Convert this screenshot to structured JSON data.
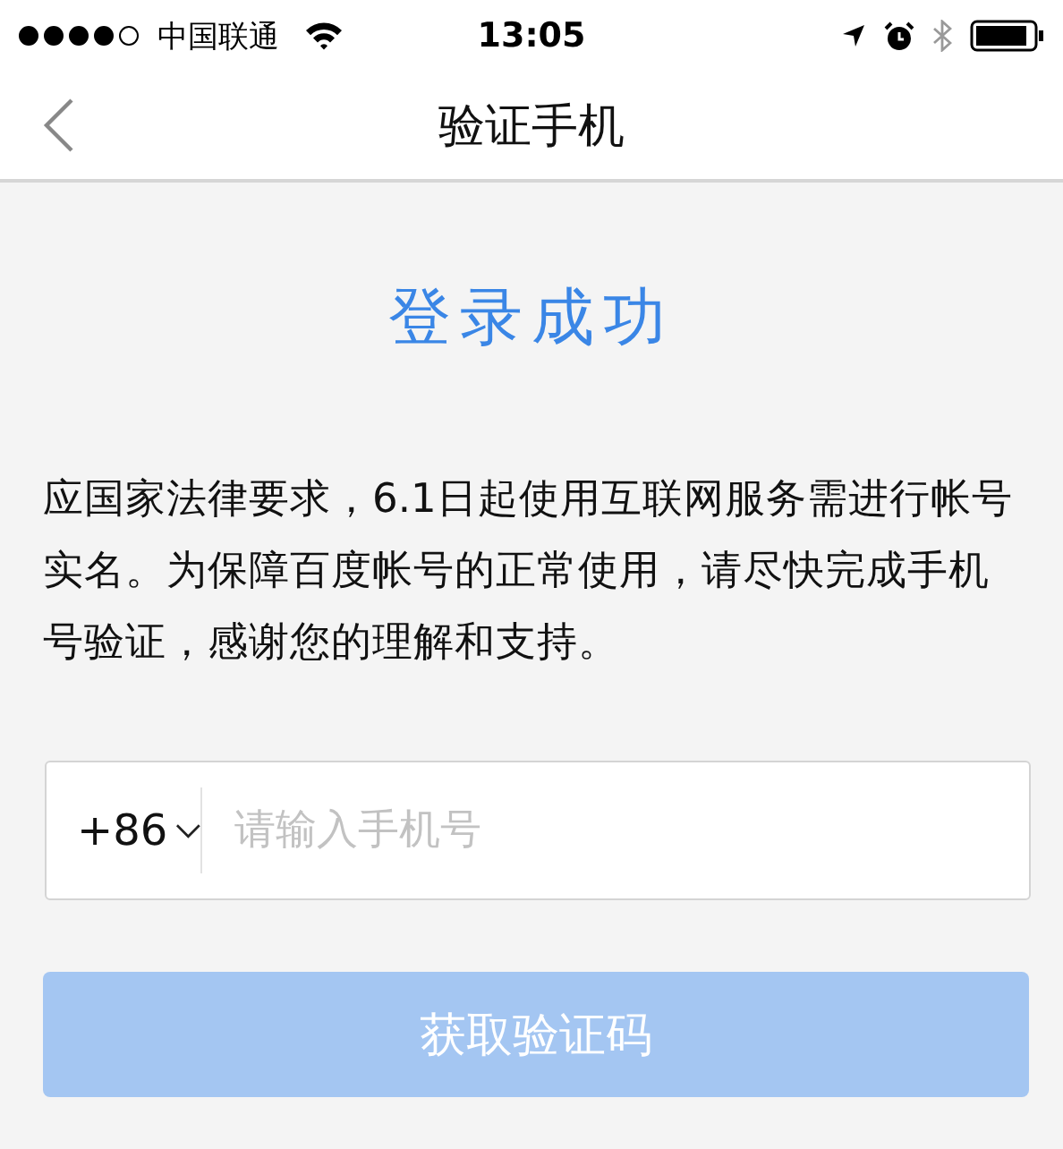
{
  "status_bar": {
    "carrier": "中国联通",
    "time": "13:05"
  },
  "nav": {
    "title": "验证手机"
  },
  "headline": "登录成功",
  "notice": "应国家法律要求，6.1日起使用互联网服务需进行帐号实名。为保障百度帐号的正常使用，请尽快完成手机号验证，感谢您的理解和支持。",
  "phone_field": {
    "country_code": "+86",
    "placeholder": "请输入手机号"
  },
  "submit_button": {
    "label": "获取验证码",
    "disabled": true
  }
}
